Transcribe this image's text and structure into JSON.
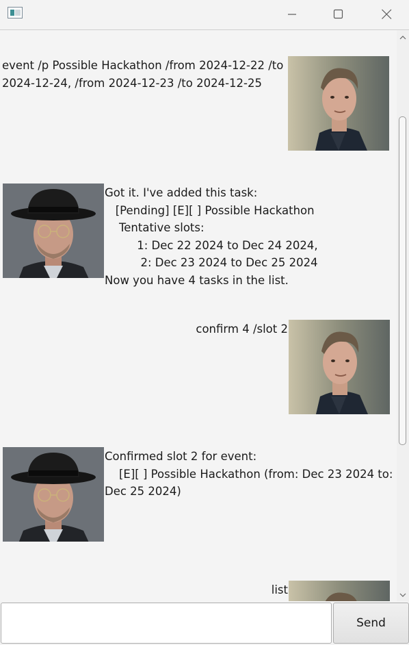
{
  "window": {
    "icons": {
      "app": "app-window-icon",
      "minimize": "minimize-icon",
      "maximize": "maximize-icon",
      "close": "close-icon"
    }
  },
  "chat": {
    "messages": [
      {
        "speaker": "user",
        "avatar": "user-avatar-young-man",
        "lines": [
          "event /p Possible Hackathon /from 2024-12-22 /to",
          "2024-12-24, /from 2024-12-23 /to 2024-12-25"
        ]
      },
      {
        "speaker": "bot",
        "avatar": "bot-avatar-man-in-hat",
        "lines": [
          "Got it. I've added this task:",
          "   [Pending] [E][ ] Possible Hackathon",
          "    Tentative slots:",
          "         1: Dec 22 2024 to Dec 24 2024,",
          "          2: Dec 23 2024 to Dec 25 2024",
          "Now you have 4 tasks in the list."
        ]
      },
      {
        "speaker": "user",
        "avatar": "user-avatar-young-man",
        "lines": [
          "confirm 4 /slot 2"
        ]
      },
      {
        "speaker": "bot",
        "avatar": "bot-avatar-man-in-hat",
        "lines": [
          "Confirmed slot 2 for event:",
          "    [E][ ] Possible Hackathon (from: Dec 23 2024 to:",
          "Dec 25 2024)"
        ]
      },
      {
        "speaker": "user",
        "avatar": "user-avatar-young-man",
        "lines": [
          "list"
        ]
      }
    ]
  },
  "input": {
    "value": "",
    "placeholder": ""
  },
  "send_button": {
    "label": "Send"
  },
  "colors": {
    "window_bg": "#f3f3f3",
    "chat_bg": "#f4f4f4",
    "text": "#1a1a1a"
  }
}
